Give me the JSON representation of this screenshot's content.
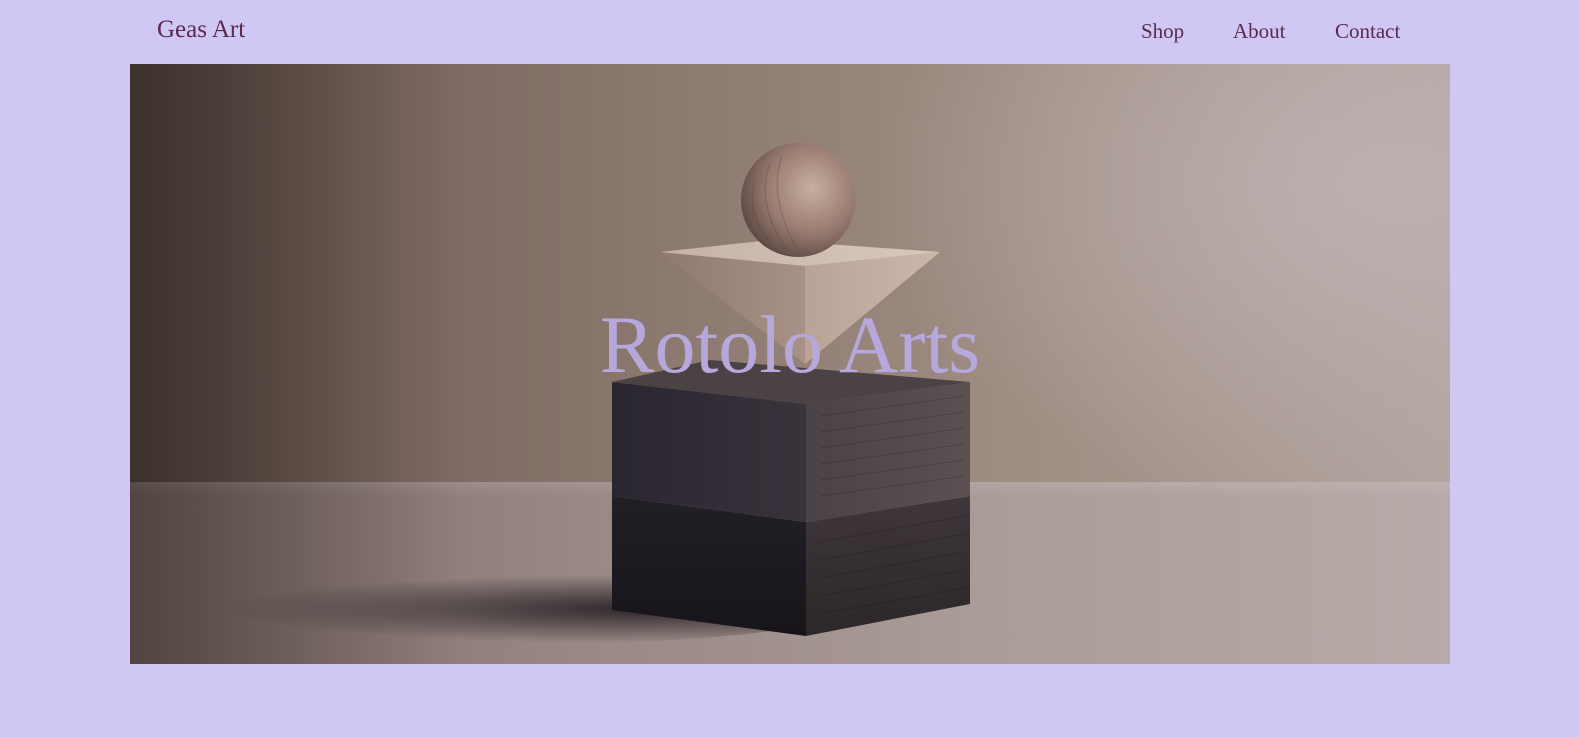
{
  "header": {
    "brand": "Geas Art",
    "nav": [
      {
        "label": "Shop"
      },
      {
        "label": "About"
      },
      {
        "label": "Contact"
      }
    ]
  },
  "hero": {
    "title": "Rotolo Arts",
    "image": "geometric-wood-sculpture"
  },
  "colors": {
    "page_background": "#d1c7f4",
    "text": "#5a2a4f",
    "hero_title": "#b7a8dc"
  }
}
